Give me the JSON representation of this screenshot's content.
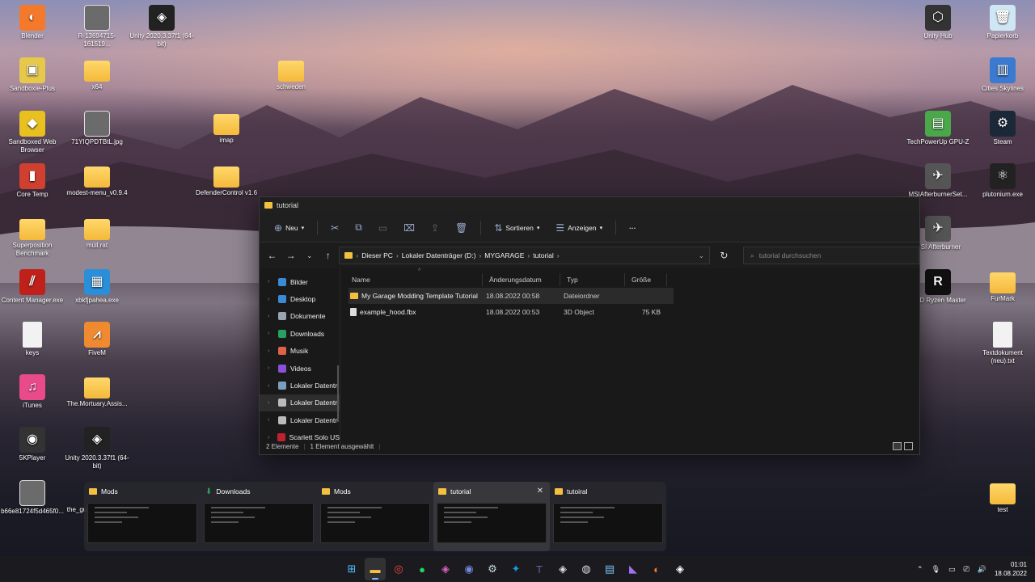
{
  "desktop": {
    "left_icons": [
      {
        "label": "Blender",
        "col": 0,
        "row": 0,
        "kind": "app",
        "color": "#f5792a",
        "glyph": "◐"
      },
      {
        "label": "R-13694715-161519...",
        "col": 1,
        "row": 0,
        "kind": "img",
        "color": "#555",
        "glyph": ""
      },
      {
        "label": "Unity 2020.3.37f1 (64-bit)",
        "col": 2,
        "row": 0,
        "kind": "app",
        "color": "#222",
        "glyph": "◈"
      },
      {
        "label": "Sandboxie-Plus",
        "col": 0,
        "row": 1,
        "kind": "app",
        "color": "#e6c84a",
        "glyph": "▣"
      },
      {
        "label": "x64",
        "col": 1,
        "row": 1,
        "kind": "folder"
      },
      {
        "label": "schweden",
        "col": 4,
        "row": 1,
        "kind": "folder"
      },
      {
        "label": "Sandboxed Web Browser",
        "col": 0,
        "row": 2,
        "kind": "app",
        "color": "#e8c020",
        "glyph": "◆"
      },
      {
        "label": "71YIQPDTBtL.jpg",
        "col": 1,
        "row": 2,
        "kind": "img",
        "color": "#666",
        "glyph": ""
      },
      {
        "label": "imap",
        "col": 3,
        "row": 2,
        "kind": "folder"
      },
      {
        "label": "Core Temp",
        "col": 0,
        "row": 3,
        "kind": "app",
        "color": "#d04030",
        "glyph": "▮"
      },
      {
        "label": "modest-menu_v0.9.4",
        "col": 1,
        "row": 3,
        "kind": "folder"
      },
      {
        "label": "DefenderControl v1.6",
        "col": 3,
        "row": 3,
        "kind": "folder"
      },
      {
        "label": "Superposition Benchmark",
        "col": 0,
        "row": 4,
        "kind": "folder"
      },
      {
        "label": "müll.rat",
        "col": 1,
        "row": 4,
        "kind": "folder"
      },
      {
        "label": "Content Manager.exe",
        "col": 0,
        "row": 5,
        "kind": "app",
        "color": "#c0201a",
        "glyph": "⫽"
      },
      {
        "label": "xbkfjpahea.exe",
        "col": 1,
        "row": 5,
        "kind": "app",
        "color": "#2a8fd8",
        "glyph": "▦"
      },
      {
        "label": "keys",
        "col": 0,
        "row": 6,
        "kind": "doc"
      },
      {
        "label": "FiveM",
        "col": 1,
        "row": 6,
        "kind": "app",
        "color": "#f08a30",
        "glyph": "⩘"
      },
      {
        "label": "iTunes",
        "col": 0,
        "row": 7,
        "kind": "app",
        "color": "#e84a8a",
        "glyph": "♫"
      },
      {
        "label": "The.Mortuary.Assis...",
        "col": 1,
        "row": 7,
        "kind": "folder"
      },
      {
        "label": "5KPlayer",
        "col": 0,
        "row": 8,
        "kind": "app",
        "color": "#333",
        "glyph": "◉"
      },
      {
        "label": "Unity 2020.3.37f1 (64-bit)",
        "col": 1,
        "row": 8,
        "kind": "app",
        "color": "#222",
        "glyph": "◈"
      },
      {
        "label": "b66e81724f5d465f0...",
        "col": 0,
        "row": 9,
        "kind": "img",
        "color": "#555",
        "glyph": ""
      }
    ],
    "right_icons": [
      {
        "label": "Unity Hub",
        "col": 0,
        "row": 0,
        "kind": "app",
        "color": "#333",
        "glyph": "⬡"
      },
      {
        "label": "Papierkorb",
        "col": 1,
        "row": 0,
        "kind": "app",
        "color": "#cfe6f5",
        "glyph": "🗑"
      },
      {
        "label": "Cities Skylines",
        "col": 1,
        "row": 1,
        "kind": "app",
        "color": "#3a7ad0",
        "glyph": "▥"
      },
      {
        "label": "TechPowerUp GPU-Z",
        "col": 0,
        "row": 2,
        "kind": "app",
        "color": "#4aa84a",
        "glyph": "▤"
      },
      {
        "label": "Steam",
        "col": 1,
        "row": 2,
        "kind": "app",
        "color": "#1b2838",
        "glyph": "⚙"
      },
      {
        "label": "MSIAfterburnerSet...",
        "col": 0,
        "row": 3,
        "kind": "app",
        "color": "#555",
        "glyph": "✈"
      },
      {
        "label": "plutonium.exe",
        "col": 1,
        "row": 3,
        "kind": "app",
        "color": "#222",
        "glyph": "⚛"
      },
      {
        "label": "MSI Afterburner",
        "col": 0,
        "row": 4,
        "kind": "app",
        "color": "#555",
        "glyph": "✈"
      },
      {
        "label": "AMD Ryzen Master",
        "col": 0,
        "row": 5,
        "kind": "app",
        "color": "#111",
        "glyph": "R"
      },
      {
        "label": "FurMark",
        "col": 1,
        "row": 5,
        "kind": "folder"
      },
      {
        "label": "Textdokument (neu).txt",
        "col": 1,
        "row": 6,
        "kind": "doc"
      },
      {
        "label": "test",
        "col": 1,
        "row": 9,
        "kind": "folder"
      }
    ],
    "partial_label": "the_gu"
  },
  "explorer": {
    "title": "tutorial",
    "toolbar": {
      "new": "Neu",
      "sort": "Sortieren",
      "view": "Anzeigen",
      "more": "···"
    },
    "path": [
      "Dieser PC",
      "Lokaler Datenträger (D:)",
      "MYGARAGE",
      "tutorial"
    ],
    "search_placeholder": "tutorial durchsuchen",
    "nav": [
      {
        "label": "Bilder",
        "color": "#3a8ad8"
      },
      {
        "label": "Desktop",
        "color": "#3a8ad8"
      },
      {
        "label": "Dokumente",
        "color": "#9aa4b0"
      },
      {
        "label": "Downloads",
        "color": "#2aa060"
      },
      {
        "label": "Musik",
        "color": "#e0604a"
      },
      {
        "label": "Videos",
        "color": "#8a50d8"
      },
      {
        "label": "Lokaler Datentr",
        "color": "#7aa0c0"
      },
      {
        "label": "Lokaler Datentr",
        "color": "#bbbbbb"
      },
      {
        "label": "Lokaler Datentr",
        "color": "#bbbbbb"
      },
      {
        "label": "Scarlett Solo US",
        "color": "#c02030"
      }
    ],
    "selected_nav": 7,
    "columns": {
      "name": "Name",
      "date": "Änderungsdatum",
      "type": "Typ",
      "size": "Größe"
    },
    "files": [
      {
        "name": "My Garage Modding Template Tutorial",
        "date": "18.08.2022 00:58",
        "type": "Dateiordner",
        "size": "",
        "kind": "folder"
      },
      {
        "name": "example_hood.fbx",
        "date": "18.08.2022 00:53",
        "type": "3D Object",
        "size": "75 KB",
        "kind": "file"
      }
    ],
    "status": {
      "count": "2 Elemente",
      "selected": "1 Element ausgewählt"
    }
  },
  "previews": [
    {
      "title": "Mods",
      "icon": "folder"
    },
    {
      "title": "Downloads",
      "icon": "download"
    },
    {
      "title": "Mods",
      "icon": "folder"
    },
    {
      "title": "tutorial",
      "icon": "folder",
      "active": true
    },
    {
      "title": "tutoiral",
      "icon": "folder"
    }
  ],
  "taskbar": {
    "apps": [
      {
        "name": "windows-start",
        "glyph": "⊞",
        "color": "#4cc2ff"
      },
      {
        "name": "file-explorer",
        "glyph": "▬",
        "color": "#f4c040",
        "active": true
      },
      {
        "name": "chrome",
        "glyph": "◎",
        "color": "#e84a3a"
      },
      {
        "name": "spotify",
        "glyph": "●",
        "color": "#1ed760"
      },
      {
        "name": "photos",
        "glyph": "◈",
        "color": "#e060c0"
      },
      {
        "name": "discord",
        "glyph": "◉",
        "color": "#7289da"
      },
      {
        "name": "steam",
        "glyph": "⚙",
        "color": "#c7d5e0"
      },
      {
        "name": "battle-net",
        "glyph": "✦",
        "color": "#1a9be0"
      },
      {
        "name": "teams",
        "glyph": "T",
        "color": "#6264a7"
      },
      {
        "name": "unity",
        "glyph": "◈",
        "color": "#ddd"
      },
      {
        "name": "obs",
        "glyph": "◍",
        "color": "#ddd"
      },
      {
        "name": "notepad",
        "glyph": "▤",
        "color": "#7ac0f0"
      },
      {
        "name": "visual-studio",
        "glyph": "◣",
        "color": "#a070f0"
      },
      {
        "name": "blender",
        "glyph": "◐",
        "color": "#f5792a"
      },
      {
        "name": "unity-editor",
        "glyph": "◈",
        "color": "#fff"
      }
    ],
    "time": "01:01",
    "date": "18.08.2022"
  }
}
